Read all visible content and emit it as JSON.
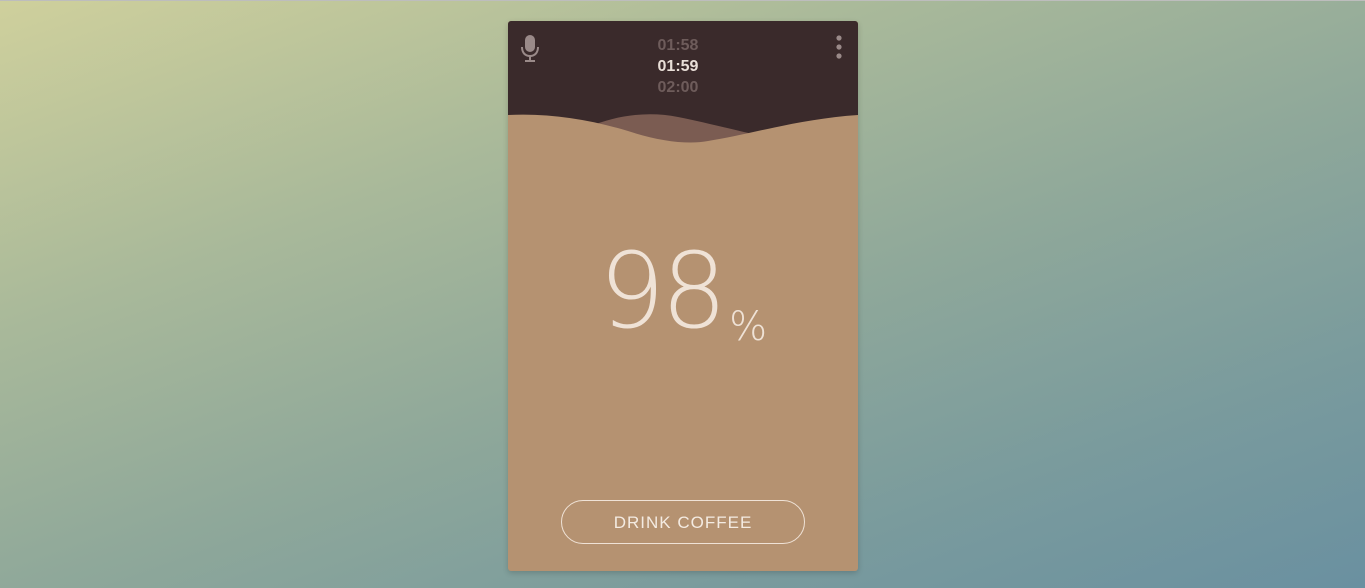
{
  "colors": {
    "header_bg": "#3a2a2b",
    "card_bg": "#b59271",
    "wave_back": "#7b5c52",
    "text_light": "#efe2d6",
    "time_dim": "#6e5c5b"
  },
  "header": {
    "mic_icon": "microphone-icon",
    "menu_icon": "more-vertical-icon",
    "times": {
      "previous": "01:58",
      "current": "01:59",
      "next": "02:00"
    }
  },
  "level": {
    "value": "98",
    "unit": "%"
  },
  "actions": {
    "drink_label": "DRINK COFFEE"
  }
}
